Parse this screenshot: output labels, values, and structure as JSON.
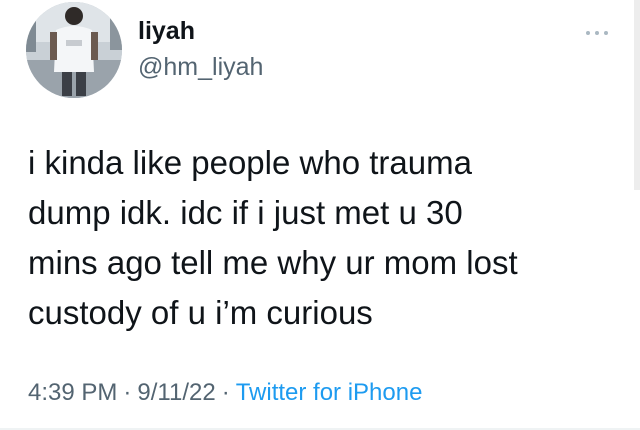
{
  "author": {
    "display_name": "liyah",
    "handle": "@hm_liyah",
    "avatar_icon": "profile-photo-avatar"
  },
  "more_icon": "more-horizontal-icon",
  "tweet": {
    "lines": [
      "i kinda like people who trauma",
      "dump idk. idc if i just met u 30",
      "mins ago tell me why ur mom lost",
      "custody of u i’m curious"
    ],
    "time": "4:39 PM",
    "date": "9/11/22",
    "separator": "·",
    "source": "Twitter for iPhone"
  },
  "colors": {
    "text": "#0f1419",
    "secondary": "#536471",
    "link": "#1d9bf0"
  }
}
